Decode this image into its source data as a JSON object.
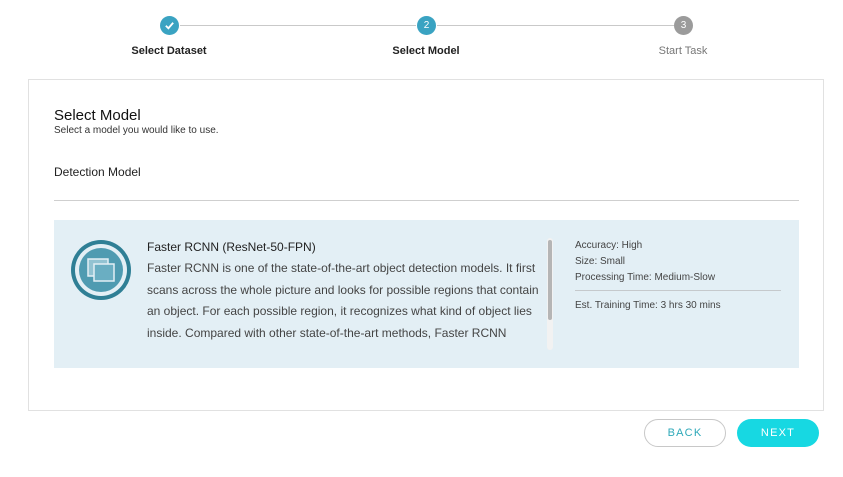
{
  "stepper": {
    "steps": [
      {
        "number": "1",
        "label": "Select Dataset",
        "state": "completed"
      },
      {
        "number": "2",
        "label": "Select Model",
        "state": "active"
      },
      {
        "number": "3",
        "label": "Start Task",
        "state": "pending"
      }
    ]
  },
  "main": {
    "title": "Select Model",
    "subtitle": "Select a model you would like to use.",
    "section_label": "Detection Model",
    "model": {
      "icon": "model-layers-icon",
      "name": "Faster RCNN (ResNet-50-FPN)",
      "description": "Faster RCNN is one of the state-of-the-art object detection models. It first scans across the whole picture and looks for possible regions that contain an object. For each possible region, it recognizes what kind of object lies inside. Compared with other state-of-the-art methods, Faster RCNN achieves better detection",
      "accuracy": "Accuracy: High",
      "size": "Size: Small",
      "processing_time": "Processing Time: Medium-Slow",
      "training_time": "Est. Training Time: 3 hrs 30 mins"
    }
  },
  "buttons": {
    "back": "BACK",
    "next": "NEXT"
  },
  "colors": {
    "step_completed": "#3aa3c2",
    "step_active": "#3aa3c2",
    "step_pending": "#9b9b9b",
    "model_bg": "#e3eff5",
    "next_button": "#17d8e2"
  }
}
